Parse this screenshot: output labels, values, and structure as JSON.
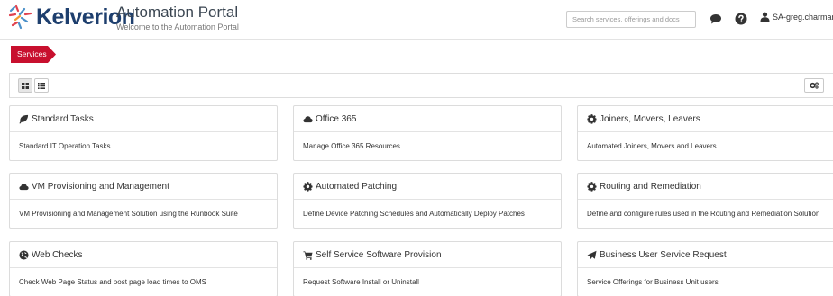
{
  "brand": {
    "logo_text": "Kelverion",
    "title": "Automation Portal",
    "subtitle": "Welcome to the Automation Portal"
  },
  "header": {
    "search_placeholder": "Search services, offerings and docs",
    "chat_icon": "chat-icon",
    "help_icon": "help-icon",
    "user_icon": "user-icon",
    "user_name": "SA-greg.charman"
  },
  "breadcrumb": {
    "label": "Services",
    "color": "#c8102e"
  },
  "toolbar": {
    "views": [
      "grid-view-icon",
      "list-view-icon"
    ],
    "active_view": "grid",
    "settings_icon": "settings-icon"
  },
  "cards": [
    {
      "icon": "leaf-icon",
      "title": "Standard Tasks",
      "description": "Standard IT Operation Tasks"
    },
    {
      "icon": "cloud-icon",
      "title": "Office 365",
      "description": "Manage Office 365 Resources"
    },
    {
      "icon": "gear-icon",
      "title": "Joiners, Movers, Leavers",
      "description": "Automated Joiners, Movers and Leavers"
    },
    {
      "icon": "cloud-icon",
      "title": "VM Provisioning and Management",
      "description": "VM Provisioning and Management Solution using the Runbook Suite"
    },
    {
      "icon": "gear-icon",
      "title": "Automated Patching",
      "description": "Define Device Patching Schedules and Automatically Deploy Patches"
    },
    {
      "icon": "gear-icon",
      "title": "Routing and Remediation",
      "description": "Define and configure rules used in the Routing and Remediation Solution"
    },
    {
      "icon": "globe-icon",
      "title": "Web Checks",
      "description": "Check Web Page Status and post page load times to OMS"
    },
    {
      "icon": "cart-icon",
      "title": "Self Service Software Provision",
      "description": "Request Software Install or Uninstall"
    },
    {
      "icon": "send-icon",
      "title": "Business User Service Request",
      "description": "Service Offerings for Business Unit users"
    }
  ]
}
